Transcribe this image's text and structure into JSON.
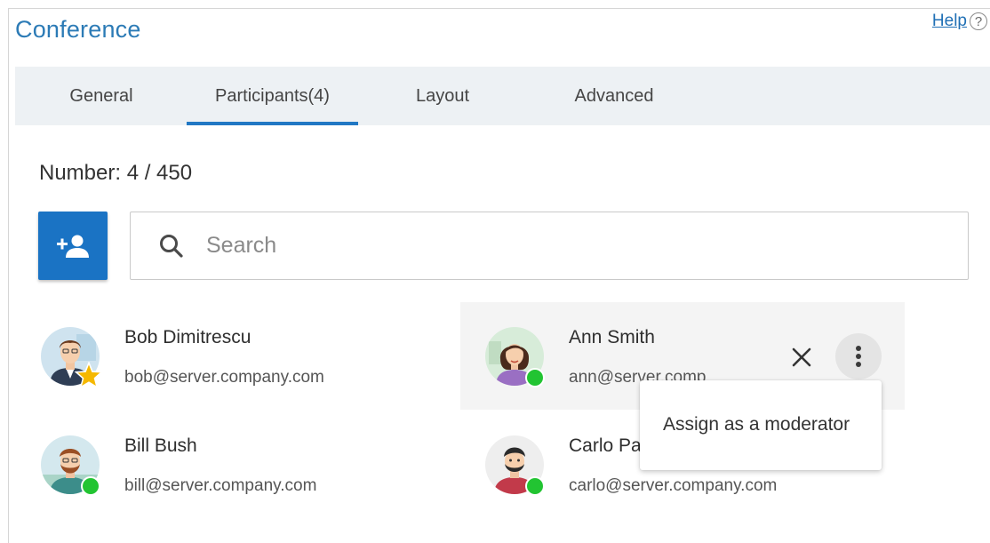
{
  "header": {
    "title": "Conference",
    "help_label": "Help",
    "help_icon": "?"
  },
  "tabs": [
    {
      "label": "General",
      "active": false
    },
    {
      "label": "Participants(4)",
      "active": true
    },
    {
      "label": "Layout",
      "active": false
    },
    {
      "label": "Advanced",
      "active": false
    }
  ],
  "summary": {
    "number_label": "Number: 4 / 450"
  },
  "toolbar": {
    "add_participant_icon": "person-add-icon",
    "search_placeholder": "Search",
    "search_value": ""
  },
  "participants": [
    {
      "name": "Bob Dimitrescu",
      "email": "bob@server.company.com",
      "badge": "moderator-star",
      "status": "none"
    },
    {
      "name": "Ann Smith",
      "email": "ann@server.comp",
      "badge": "none",
      "status": "online"
    },
    {
      "name": "Bill Bush",
      "email": "bill@server.company.com",
      "badge": "none",
      "status": "online"
    },
    {
      "name": "Carlo Pa",
      "email": "carlo@server.company.com",
      "badge": "none",
      "status": "online"
    }
  ],
  "context_menu": {
    "items": [
      {
        "label": "Assign as a moderator"
      }
    ]
  },
  "colors": {
    "accent": "#1a73c4",
    "title": "#2c7bb6",
    "online": "#22c432",
    "star": "#f5b800",
    "tabbar_bg": "#edf1f4"
  }
}
